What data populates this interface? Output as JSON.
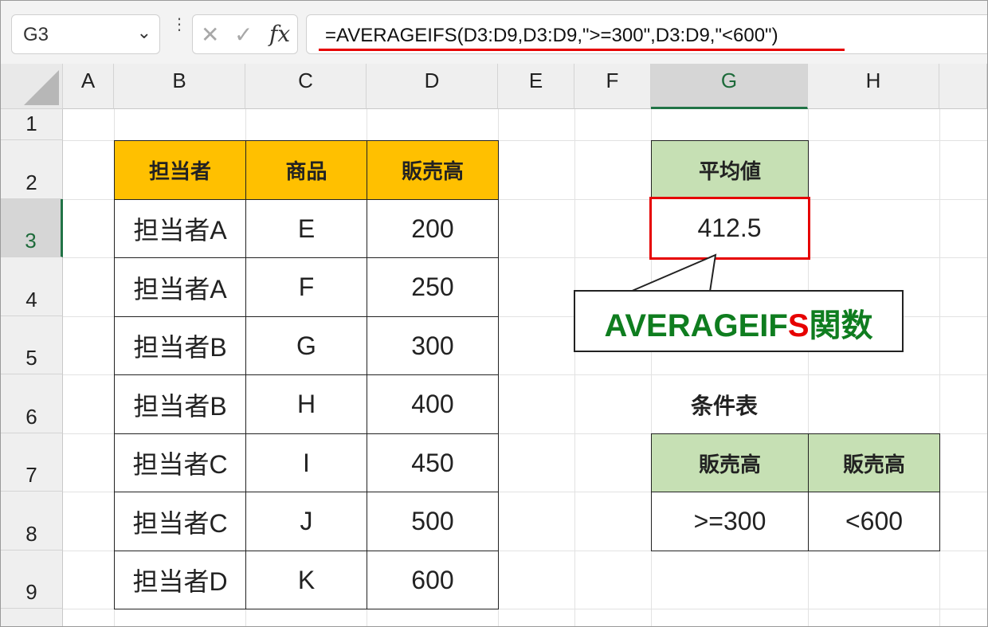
{
  "namebox": {
    "value": "G3",
    "chevron": "chevron-down-icon"
  },
  "formula_bar": {
    "more_icon": "vertical-dots-icon",
    "cancel_icon": "close-icon",
    "enter_icon": "checkmark-icon",
    "fx_label": "fx",
    "formula": "=AVERAGEIFS(D3:D9,D3:D9,\">=300\",D3:D9,\"<600\")"
  },
  "columns": [
    "A",
    "B",
    "C",
    "D",
    "E",
    "F",
    "G",
    "H"
  ],
  "selected_column": "G",
  "rows": [
    "1",
    "2",
    "3",
    "4",
    "5",
    "6",
    "7",
    "8",
    "9"
  ],
  "selected_row": "3",
  "table": {
    "headers": [
      "担当者",
      "商品",
      "販売高"
    ],
    "rows": [
      [
        "担当者A",
        "E",
        "200"
      ],
      [
        "担当者A",
        "F",
        "250"
      ],
      [
        "担当者B",
        "G",
        "300"
      ],
      [
        "担当者B",
        "H",
        "400"
      ],
      [
        "担当者C",
        "I",
        "450"
      ],
      [
        "担当者C",
        "J",
        "500"
      ],
      [
        "担当者D",
        "K",
        "600"
      ]
    ]
  },
  "average": {
    "header": "平均値",
    "value": "412.5"
  },
  "callout": {
    "part1": "AVERAGEIF",
    "part2": "S",
    "part3": "関数"
  },
  "criteria": {
    "title": "条件表",
    "headers": [
      "販売高",
      "販売高"
    ],
    "values": [
      ">=300",
      "<600"
    ]
  },
  "colors": {
    "header_orange": "#ffc000",
    "header_green": "#c6e0b4",
    "highlight_red": "#e60000",
    "excel_green": "#217346"
  }
}
